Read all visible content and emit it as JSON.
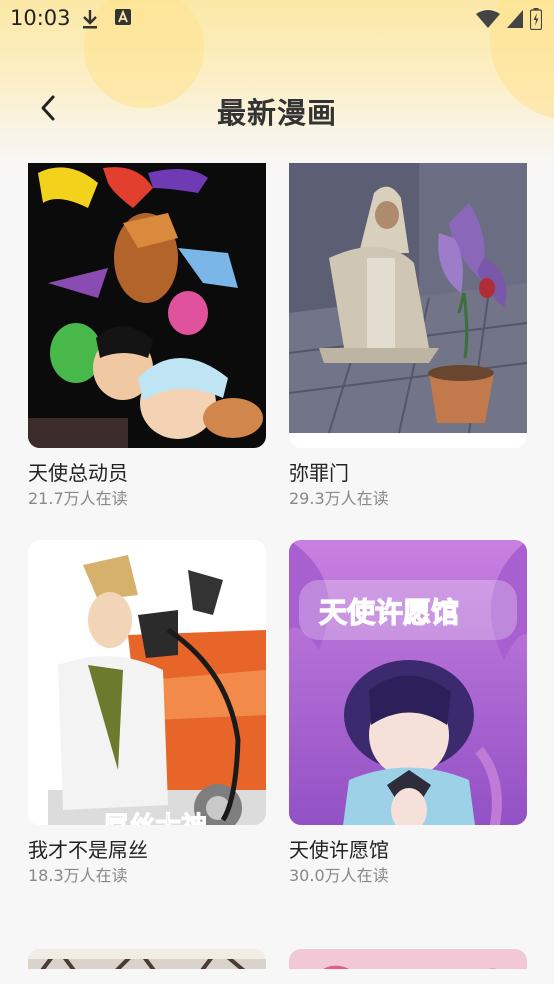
{
  "status_bar": {
    "time": "10:03",
    "left_icons": [
      "download-icon",
      "a-notification-icon"
    ],
    "right_icons": [
      "wifi-icon",
      "signal-icon",
      "battery-charging-icon"
    ]
  },
  "nav": {
    "back_icon": "chevron-left-icon",
    "title": "最新漫画"
  },
  "colors": {
    "header_gradient_top": "#fbe8a6",
    "page_background": "#f7f7f7",
    "title_text": "#333333",
    "secondary_text": "#888888"
  },
  "comics": [
    {
      "title": "天使总动员",
      "readers": "21.7万人在读",
      "cover_theme": "black-background-cartoon-cast"
    },
    {
      "title": "弥罪门",
      "readers": "29.3万人在读",
      "cover_theme": "hooded-figure-with-purple-plant"
    },
    {
      "title": "我才不是屌丝",
      "readers": "18.3万人在读",
      "cover_theme": "man-with-fuel-nozzle-and-orange-car"
    },
    {
      "title": "天使许愿馆",
      "readers": "30.0万人在读",
      "cover_theme": "purple-haired-girl-praying"
    },
    {
      "title": "",
      "readers": "",
      "cover_theme": "partially-visible-cover"
    },
    {
      "title": "",
      "readers": "",
      "cover_theme": "partially-visible-cover"
    }
  ],
  "cover_logos": {
    "comic_3": "屌丝大神",
    "comic_4": "天使许愿馆"
  }
}
